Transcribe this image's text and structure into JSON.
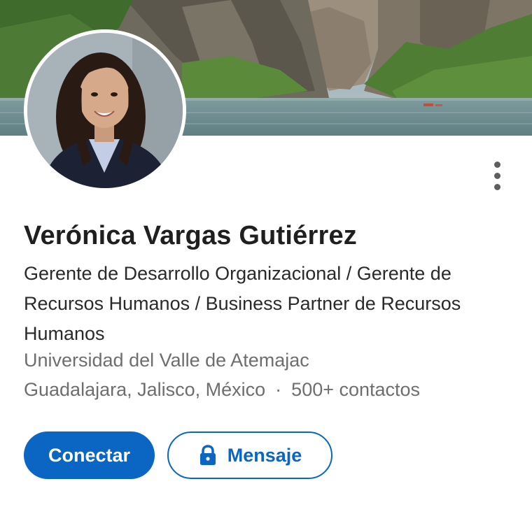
{
  "profile": {
    "name": "Verónica Vargas Gutiérrez",
    "headline": "Gerente de Desarrollo Organizacional / Gerente de Recursos Humanos / Business Partner de Recursos Humanos",
    "school": "Universidad del Valle de Atemajac",
    "location": "Guadalajara, Jalisco, México",
    "separator": "·",
    "connections": "500+ contactos"
  },
  "actions": {
    "connect_label": "Conectar",
    "message_label": "Mensaje"
  },
  "icons": {
    "more": "more-vertical-icon",
    "lock": "lock-icon"
  },
  "colors": {
    "primary": "#0a66c2",
    "text": "#1f1f1f",
    "muted": "#6e6e6e"
  }
}
